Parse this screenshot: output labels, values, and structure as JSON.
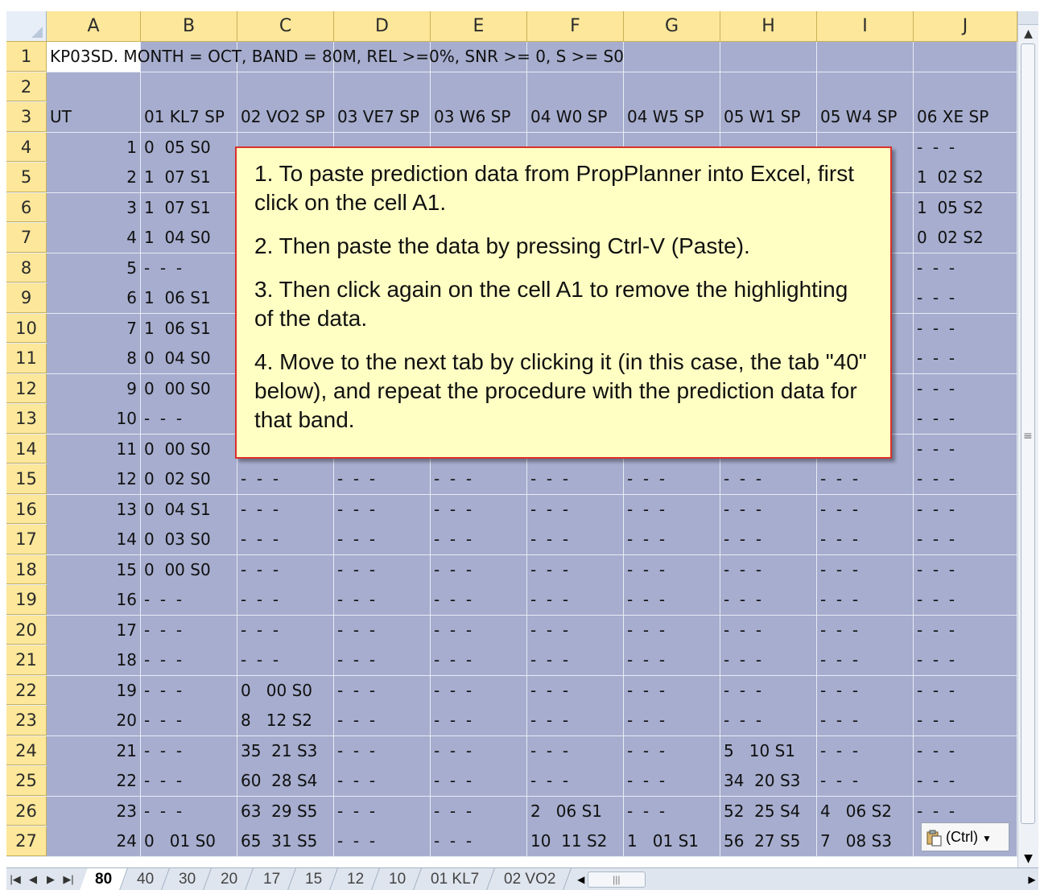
{
  "columns": [
    "A",
    "B",
    "C",
    "D",
    "E",
    "F",
    "G",
    "H",
    "I",
    "J"
  ],
  "title_cell": "KP03SD. MONTH = OCT, BAND = 80M, REL >=0%, SNR >= 0, S >= S0",
  "headers": [
    "UT",
    "01 KL7 SP",
    "02 VO2 SP",
    "03 VE7 SP",
    "03 W6 SP",
    "04 W0 SP",
    "04 W5 SP",
    "05 W1 SP",
    "05 W4 SP",
    "06 XE SP"
  ],
  "rows": [
    {
      "n": "4",
      "cells": [
        "1",
        "0  05 S0",
        "",
        "",
        "",
        "",
        "",
        "",
        "",
        "-  -  -"
      ]
    },
    {
      "n": "5",
      "cells": [
        "2",
        "1  07 S1",
        "",
        "",
        "",
        "",
        "",
        "",
        "",
        "1  02 S2"
      ]
    },
    {
      "n": "6",
      "cells": [
        "3",
        "1  07 S1",
        "",
        "",
        "",
        "",
        "",
        "",
        "",
        "1  05 S2"
      ]
    },
    {
      "n": "7",
      "cells": [
        "4",
        "1  04 S0",
        "",
        "",
        "",
        "",
        "",
        "",
        "",
        "0  02 S2"
      ]
    },
    {
      "n": "8",
      "cells": [
        "5",
        "-  -  -",
        "",
        "",
        "",
        "",
        "",
        "",
        "",
        "-  -  -"
      ]
    },
    {
      "n": "9",
      "cells": [
        "6",
        "1  06 S1",
        "",
        "",
        "",
        "",
        "",
        "",
        "",
        "-  -  -"
      ]
    },
    {
      "n": "10",
      "cells": [
        "7",
        "1  06 S1",
        "",
        "",
        "",
        "",
        "",
        "",
        "",
        "-  -  -"
      ]
    },
    {
      "n": "11",
      "cells": [
        "8",
        "0  04 S0",
        "",
        "",
        "",
        "",
        "",
        "",
        "",
        "-  -  -"
      ]
    },
    {
      "n": "12",
      "cells": [
        "9",
        "0  00 S0",
        "",
        "",
        "",
        "",
        "",
        "",
        "",
        "-  -  -"
      ]
    },
    {
      "n": "13",
      "cells": [
        "10",
        "-  -  -",
        "",
        "",
        "",
        "",
        "",
        "",
        "",
        "-  -  -"
      ]
    },
    {
      "n": "14",
      "cells": [
        "11",
        "0  00 S0",
        "",
        "",
        "",
        "",
        "",
        "",
        "",
        "-  -  -"
      ]
    },
    {
      "n": "15",
      "cells": [
        "12",
        "0  02 S0",
        "-  -  -",
        "-  -  -",
        "-  -  -",
        "-  -  -",
        "-  -  -",
        "-  -  -",
        "-  -  -",
        "-  -  -"
      ]
    },
    {
      "n": "16",
      "cells": [
        "13",
        "0  04 S1",
        "-  -  -",
        "-  -  -",
        "-  -  -",
        "-  -  -",
        "-  -  -",
        "-  -  -",
        "-  -  -",
        "-  -  -"
      ]
    },
    {
      "n": "17",
      "cells": [
        "14",
        "0  03 S0",
        "-  -  -",
        "-  -  -",
        "-  -  -",
        "-  -  -",
        "-  -  -",
        "-  -  -",
        "-  -  -",
        "-  -  -"
      ]
    },
    {
      "n": "18",
      "cells": [
        "15",
        "0  00 S0",
        "-  -  -",
        "-  -  -",
        "-  -  -",
        "-  -  -",
        "-  -  -",
        "-  -  -",
        "-  -  -",
        "-  -  -"
      ]
    },
    {
      "n": "19",
      "cells": [
        "16",
        "-  -  -",
        "-  -  -",
        "-  -  -",
        "-  -  -",
        "-  -  -",
        "-  -  -",
        "-  -  -",
        "-  -  -",
        "-  -  -"
      ]
    },
    {
      "n": "20",
      "cells": [
        "17",
        "-  -  -",
        "-  -  -",
        "-  -  -",
        "-  -  -",
        "-  -  -",
        "-  -  -",
        "-  -  -",
        "-  -  -",
        "-  -  -"
      ]
    },
    {
      "n": "21",
      "cells": [
        "18",
        "-  -  -",
        "-  -  -",
        "-  -  -",
        "-  -  -",
        "-  -  -",
        "-  -  -",
        "-  -  -",
        "-  -  -",
        "-  -  -"
      ]
    },
    {
      "n": "22",
      "cells": [
        "19",
        "-  -  -",
        "0   00 S0",
        "-  -  -",
        "-  -  -",
        "-  -  -",
        "-  -  -",
        "-  -  -",
        "-  -  -",
        "-  -  -"
      ]
    },
    {
      "n": "23",
      "cells": [
        "20",
        "-  -  -",
        "8   12 S2",
        "-  -  -",
        "-  -  -",
        "-  -  -",
        "-  -  -",
        "-  -  -",
        "-  -  -",
        "-  -  -"
      ]
    },
    {
      "n": "24",
      "cells": [
        "21",
        "-  -  -",
        "35  21 S3",
        "-  -  -",
        "-  -  -",
        "-  -  -",
        "-  -  -",
        "5   10 S1",
        "-  -  -",
        "-  -  -"
      ]
    },
    {
      "n": "25",
      "cells": [
        "22",
        "-  -  -",
        "60  28 S4",
        "-  -  -",
        "-  -  -",
        "-  -  -",
        "-  -  -",
        "34  20 S3",
        "-  -  -",
        "-  -  -"
      ]
    },
    {
      "n": "26",
      "cells": [
        "23",
        "-  -  -",
        "63  29 S5",
        "-  -  -",
        "-  -  -",
        "2   06 S1",
        "-  -  -",
        "52  25 S4",
        "4   06 S2",
        "-  -  -"
      ]
    },
    {
      "n": "27",
      "cells": [
        "24",
        "0   01 S0",
        "65  31 S5",
        "-  -  -",
        "-  -  -",
        "10  11 S2",
        "1   01 S1",
        "56  27 S5",
        "7   08 S3",
        ""
      ]
    }
  ],
  "callout": {
    "p1": "1. To paste prediction data from PropPlanner into Excel, first click on the cell A1.",
    "p2": "2. Then paste the data by pressing Ctrl-V (Paste).",
    "p3": "3. Then click again on the cell A1 to remove the highlighting of the data.",
    "p4": "4. Move to the next tab by clicking it (in this case, the tab \"40\" below), and repeat the procedure with the prediction data for that band."
  },
  "paste_options_label": "(Ctrl)",
  "tabs": [
    "80",
    "40",
    "30",
    "20",
    "17",
    "15",
    "12",
    "10",
    "01 KL7",
    "02 VO2"
  ],
  "active_tab": "80",
  "colors": {
    "selection": "#a6adce",
    "header": "#fce79a",
    "callout_bg": "#ffffc4",
    "callout_border": "#d9302c"
  }
}
